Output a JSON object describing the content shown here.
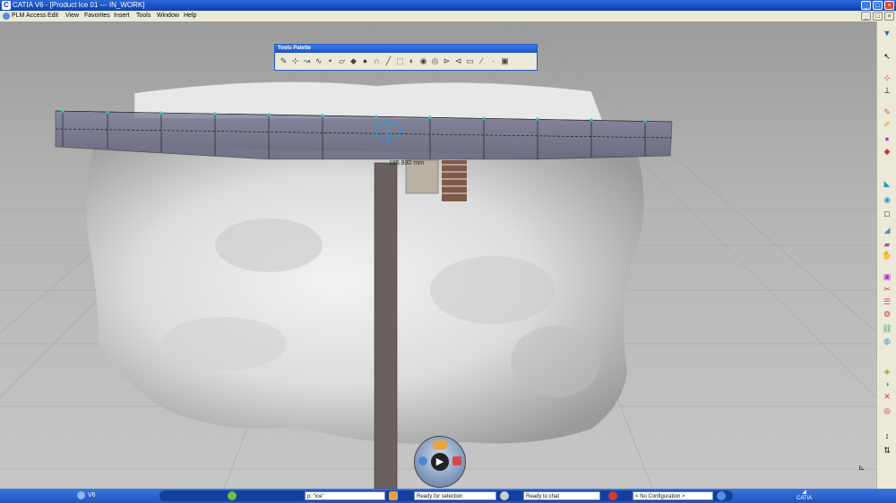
{
  "window": {
    "title": "CATIA V6 - [Product Ice 01 --- IN_WORK]",
    "logo_text": "C"
  },
  "window_controls": {
    "minimize": "_",
    "restore": "□",
    "close": "×"
  },
  "menu": [
    "PLM Access",
    "Edit",
    "View",
    "Favorites",
    "Insert",
    "Tools",
    "Window",
    "Help"
  ],
  "menu_controls": {
    "minimize": "_",
    "restore": "□",
    "close": "×"
  },
  "tools_palette": {
    "title": "Tools Palette",
    "tools": [
      "sketch-icon",
      "axis-icon",
      "curve-icon",
      "spline-icon",
      "point-icon",
      "plane-icon",
      "surface-icon",
      "sphere-icon",
      "magnet-icon",
      "line-icon",
      "select-icon",
      "sculpt-icon",
      "smooth-icon",
      "blend-icon",
      "push-icon",
      "pull-icon",
      "flatten-icon",
      "pencil-icon",
      "close-curve-icon",
      "cube-icon"
    ]
  },
  "viewport": {
    "measurement": "195.930 mm"
  },
  "right_toolbar": {
    "icons": [
      "sculpt-app-icon",
      "select-arrow-icon",
      "point-icon",
      "plane-icon",
      "pencil-icon",
      "brush-icon",
      "sphere-icon",
      "box-icon",
      "curve-icon",
      "extrude-icon",
      "fill-icon",
      "square-icon",
      "paint-icon",
      "cut-icon",
      "hand-icon",
      "cube-icon",
      "stack-icon",
      "gear-icon",
      "link-icon",
      "layer-icon",
      "measure-icon",
      "globe-icon",
      "paint-bucket-icon",
      "cross-icon",
      "circle-icon",
      "bookmark-icon",
      "arrow-icon"
    ]
  },
  "compass": {
    "play": "▶"
  },
  "status_bar": {
    "version": "V6",
    "search_field": "p: \"ice\"",
    "selection_status": "Ready for selection",
    "chat_status": "Ready to chat",
    "configuration": "< No Configuration >",
    "brand": "CATIA"
  },
  "colors": {
    "title_bar": "#0c3fb0",
    "taskbar": "#1f55c2",
    "menu_bg": "#ece9d8",
    "ice": "#e6e6e6",
    "band": "#6d6d8a"
  }
}
